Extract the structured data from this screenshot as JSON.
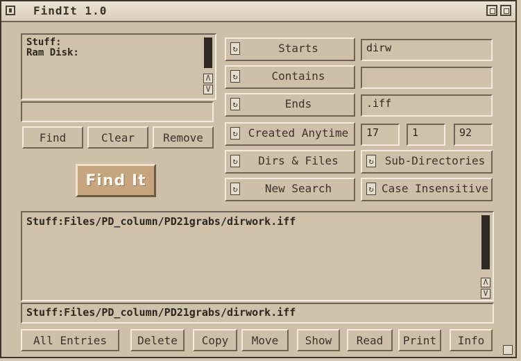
{
  "window": {
    "title": "FindIt 1.0"
  },
  "volumes": {
    "items": [
      "Stuff:",
      "Ram Disk:"
    ]
  },
  "path_input": {
    "value": ""
  },
  "left_buttons": {
    "find": "Find",
    "clear": "Clear",
    "remove": "Remove"
  },
  "find_it_button": "Find It",
  "criteria": {
    "starts": {
      "label": "Starts",
      "value": "dirw"
    },
    "contains": {
      "label": "Contains",
      "value": ""
    },
    "ends": {
      "label": "Ends",
      "value": ".iff"
    },
    "created": {
      "label": "Created Anytime",
      "day": "17",
      "month": "1",
      "year": "92"
    },
    "dirs": {
      "label": "Dirs & Files"
    },
    "subdirs": {
      "label": "Sub-Directories"
    },
    "new_search": {
      "label": "New Search"
    },
    "case": {
      "label": "Case Insensitive"
    }
  },
  "results": {
    "items": [
      "Stuff:Files/PD_column/PD21grabs/dirwork.iff"
    ],
    "selected": "Stuff:Files/PD_column/PD21grabs/dirwork.iff"
  },
  "bottom_buttons": {
    "all_entries": "All Entries",
    "delete": "Delete",
    "copy": "Copy",
    "move": "Move",
    "show": "Show",
    "read": "Read",
    "print": "Print",
    "info": "Info"
  },
  "icons": {
    "cycle": "cycle-icon",
    "up": "arrow-up-icon",
    "down": "arrow-down-icon"
  },
  "arrow_up_glyph": "Λ",
  "arrow_down_glyph": "V",
  "cycle_glyph": "↻"
}
